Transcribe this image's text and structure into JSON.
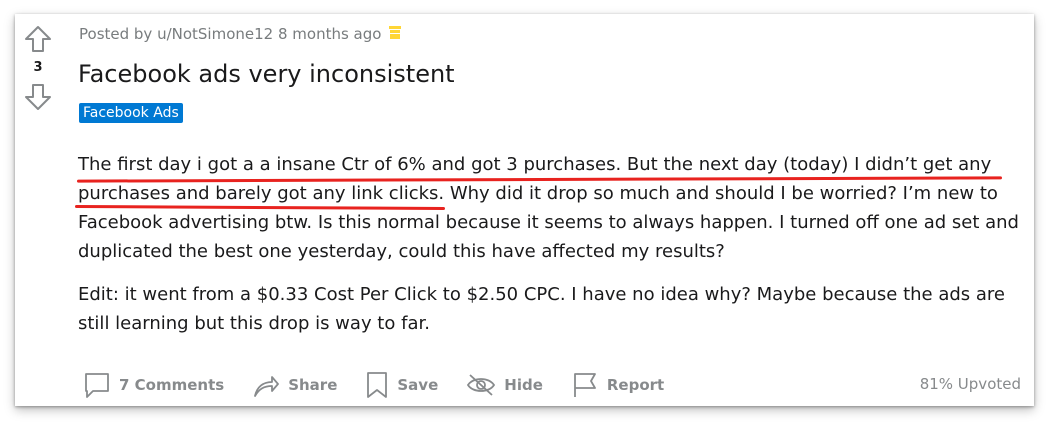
{
  "post": {
    "meta_text": "Posted by u/NotSimone12 8 months ago",
    "score": "3",
    "title": "Facebook ads very inconsistent",
    "flair": "Facebook Ads",
    "paragraph1_highlighted": "The first day i got a a insane Ctr of 6% and got 3 purchases. But the next day (today) I didn’t get any purchases and barely got any link clicks",
    "paragraph1_rest": ". Why did it drop so much and should I be worried? I’m new to Facebook advertising btw. Is this normal because it seems to always happen. I turned off one ad set and duplicated the best one yesterday, could this have affected my results?",
    "paragraph2": "Edit: it went from a $0.33 Cost Per Click to $2.50 CPC. I have no idea why? Maybe because the ads are still learning but this drop is way to far.",
    "upvoted": "81% Upvoted"
  },
  "actions": {
    "comments": "7 Comments",
    "share": "Share",
    "save": "Save",
    "hide": "Hide",
    "report": "Report"
  },
  "icons": {
    "upvote": "upvote-arrow-icon",
    "downvote": "downvote-arrow-icon",
    "award": "award-icon",
    "comment": "comment-icon",
    "share": "share-icon",
    "save": "bookmark-icon",
    "hide": "hide-eye-icon",
    "report": "flag-icon"
  },
  "colors": {
    "flair_bg": "#0079d3",
    "highlight_underline": "#e8231f",
    "award": "#ffd635",
    "muted_text": "#787c7e"
  }
}
